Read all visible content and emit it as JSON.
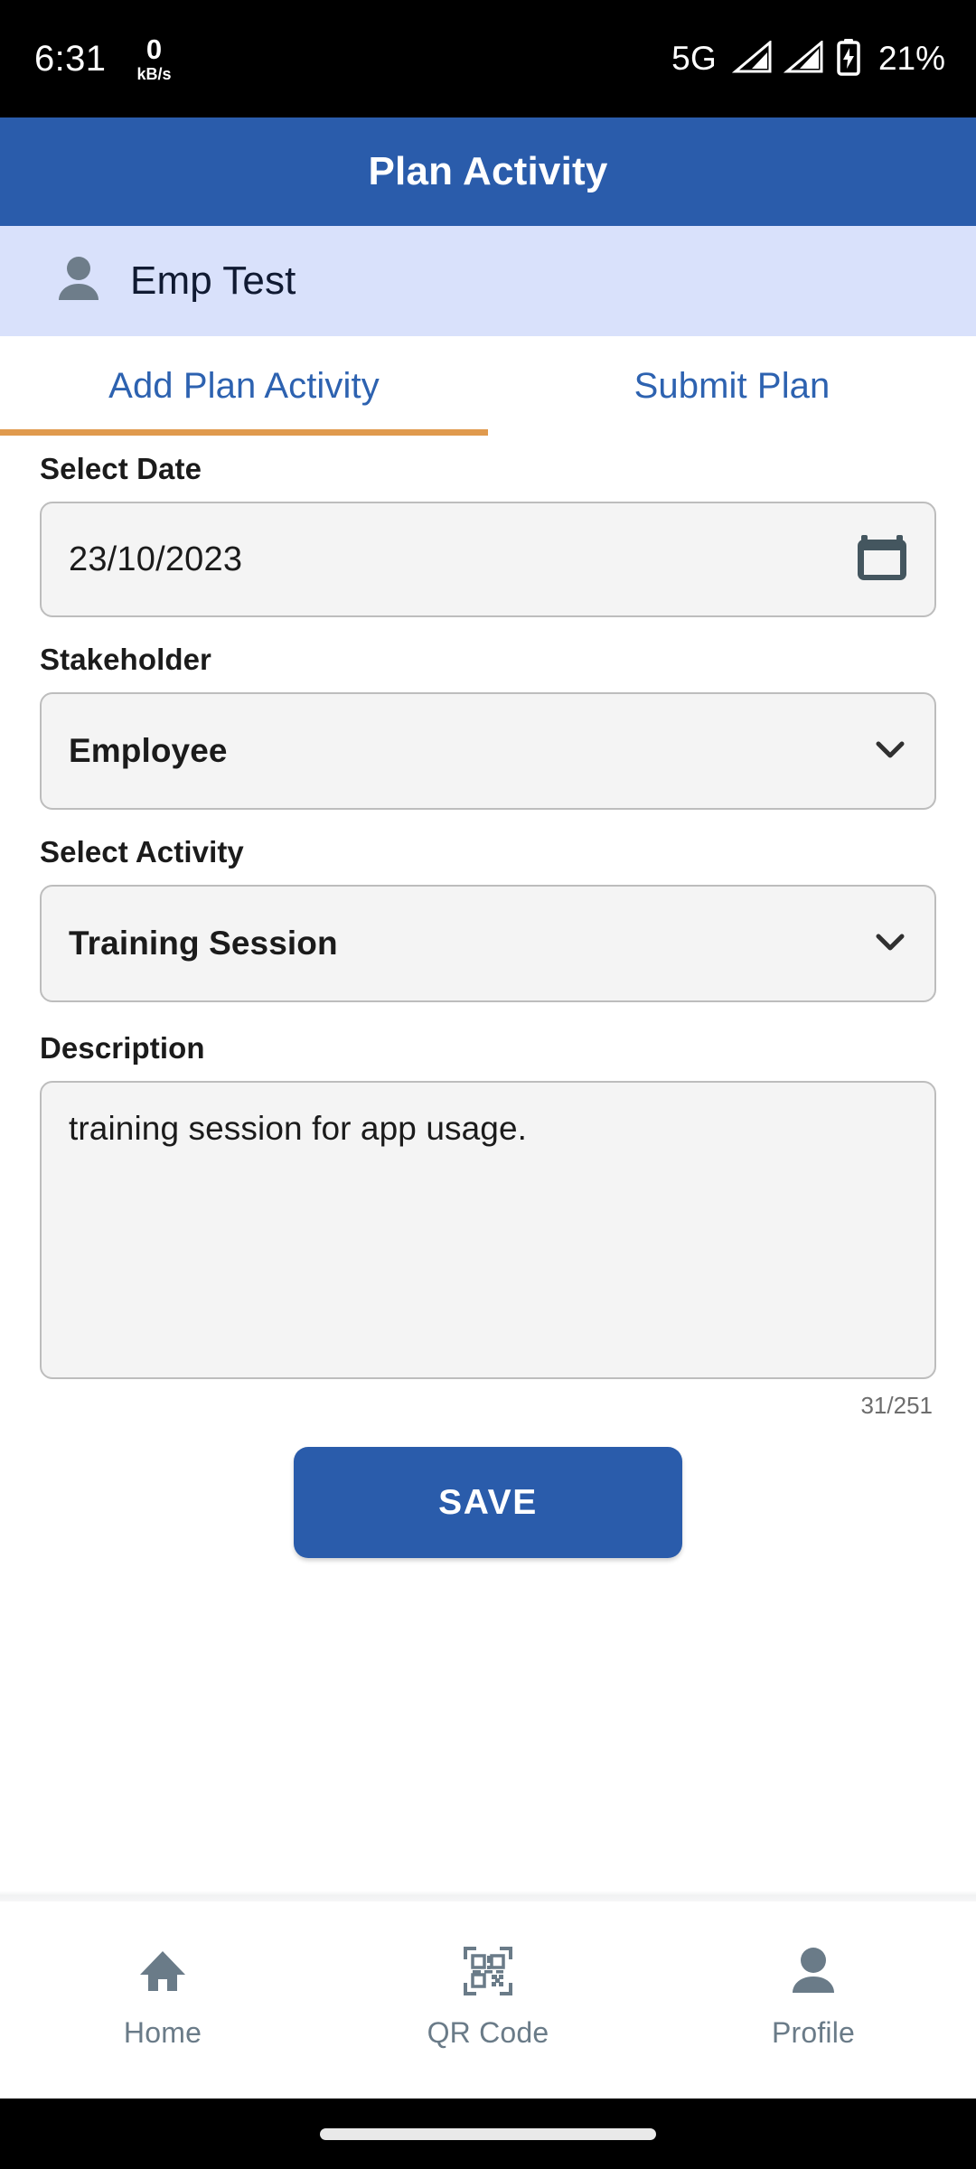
{
  "status_bar": {
    "clock": "6:31",
    "net_rate": "0",
    "net_unit": "kB/s",
    "network_type": "5G",
    "battery_percent": "21%",
    "icons": [
      "signal-bars-icon",
      "signal-bars-icon",
      "battery-charging-icon"
    ]
  },
  "app_bar": {
    "title": "Plan Activity"
  },
  "user_bar": {
    "name": "Emp Test",
    "avatar_icon": "person-icon"
  },
  "tabs": {
    "items": [
      {
        "label": "Add Plan Activity",
        "active": true
      },
      {
        "label": "Submit Plan",
        "active": false
      }
    ],
    "indicator_color": "#e09a4e",
    "label_color": "#2d62b0"
  },
  "form": {
    "date": {
      "label": "Select Date",
      "value": "23/10/2023",
      "icon": "calendar-icon"
    },
    "stakeholder": {
      "label": "Stakeholder",
      "value": "Employee",
      "icon": "chevron-down-icon"
    },
    "activity": {
      "label": "Select Activity",
      "value": "Training Session",
      "icon": "chevron-down-icon"
    },
    "description": {
      "label": "Description",
      "value": "training session for app usage.",
      "counter": "31/251"
    },
    "save_label": "SAVE"
  },
  "bottom_nav": {
    "items": [
      {
        "label": "Home",
        "icon": "home-icon"
      },
      {
        "label": "QR Code",
        "icon": "qr-code-icon"
      },
      {
        "label": "Profile",
        "icon": "person-icon"
      }
    ],
    "icon_color": "#6a7b88"
  },
  "theme": {
    "primary_blue": "#2a5cab",
    "user_bar_bg": "#d9e1fb",
    "accent_orange": "#e09a4e",
    "field_bg": "#f4f4f4",
    "field_border": "#bdbdbd"
  }
}
